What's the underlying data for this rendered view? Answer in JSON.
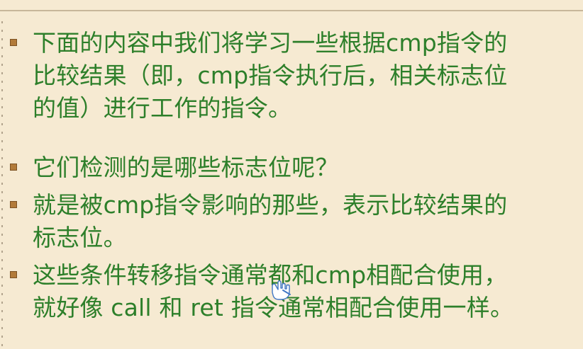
{
  "slide": {
    "bullets": [
      {
        "text": "下面的内容中我们将学习一些根据cmp指令的\n比较结果（即，cmp指令执行后，相关标志位\n的值）进行工作的指令。"
      },
      {
        "text": "它们检测的是哪些标志位呢？"
      },
      {
        "text": "就是被cmp指令影响的那些，表示比较结果的\n标志位。"
      },
      {
        "text": "这些条件转移指令通常都和cmp相配合使用，\n就好像 call 和 ret 指令通常相配合使用一样。"
      }
    ]
  },
  "colors": {
    "background": "#f6ead2",
    "text": "#2d7f2a",
    "bullet": "#b27b3a"
  }
}
